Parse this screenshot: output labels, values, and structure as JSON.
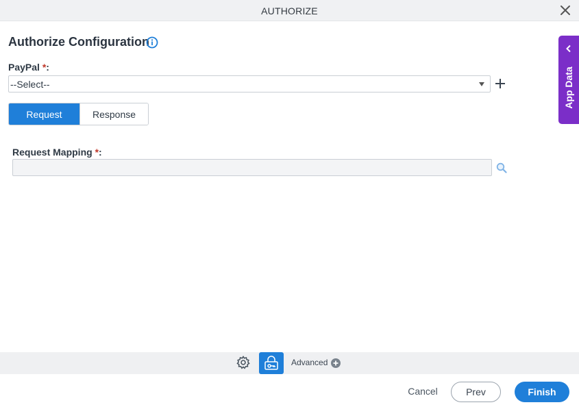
{
  "dialog": {
    "title": "AUTHORIZE"
  },
  "config": {
    "heading": "Authorize Configuration"
  },
  "paypal": {
    "label": "PayPal",
    "required_mark": "*",
    "colon": ":",
    "selected": "--Select--"
  },
  "tabs": [
    {
      "label": "Request",
      "active": true
    },
    {
      "label": "Response",
      "active": false
    }
  ],
  "request_mapping": {
    "label": "Request Mapping",
    "required_mark": "*",
    "colon": ":",
    "value": ""
  },
  "side_panel": {
    "label": "App Data"
  },
  "toolbar": {
    "advanced_label": "Advanced"
  },
  "footer": {
    "cancel_label": "Cancel",
    "prev_label": "Prev",
    "finish_label": "Finish"
  },
  "colors": {
    "primary": "#1f7fd9",
    "app_data": "#7b2ec8",
    "required": "#c0392b"
  },
  "icons": [
    "close-icon",
    "info-icon",
    "plus-icon",
    "search-icon",
    "chevron-left-icon",
    "gear-icon",
    "lock-key-icon",
    "add-circle-icon"
  ]
}
